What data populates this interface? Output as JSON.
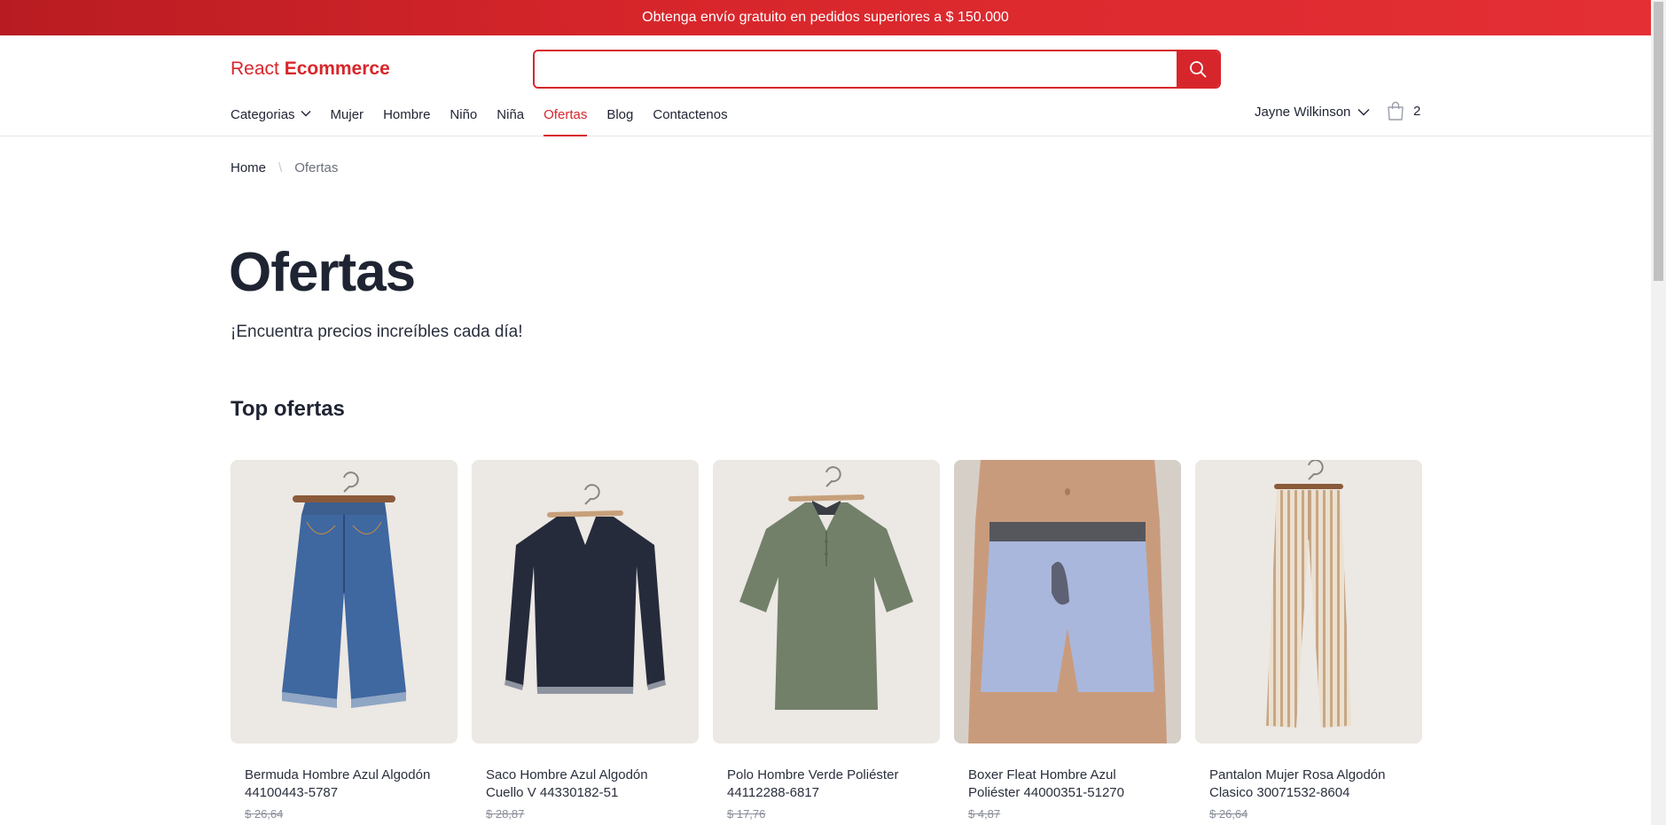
{
  "promo": {
    "text": "Obtenga envío gratuito en pedidos superiores a $ 150.000"
  },
  "logo": {
    "part1": "React ",
    "part2": "Ecommerce"
  },
  "search": {
    "placeholder": "",
    "value": ""
  },
  "nav": {
    "items": [
      {
        "label": "Categorias",
        "has_dropdown": true
      },
      {
        "label": "Mujer"
      },
      {
        "label": "Hombre"
      },
      {
        "label": "Niño"
      },
      {
        "label": "Niña"
      },
      {
        "label": "Ofertas",
        "active": true
      },
      {
        "label": "Blog"
      },
      {
        "label": "Contactenos"
      }
    ]
  },
  "user": {
    "name": "Jayne Wilkinson"
  },
  "cart": {
    "count": "2"
  },
  "breadcrumb": {
    "home": "Home",
    "current": "Ofertas"
  },
  "page": {
    "title": "Ofertas",
    "subtitle": "¡Encuentra precios increíbles cada día!",
    "section_title": "Top ofertas"
  },
  "products": [
    {
      "name": "Bermuda Hombre Azul Algodón 44100443-5787",
      "price": "$ 26,64",
      "icon": "denim-shorts-image"
    },
    {
      "name": "Saco Hombre Azul Algodón Cuello V 44330182-51",
      "price": "$ 28,87",
      "icon": "sweater-image"
    },
    {
      "name": "Polo Hombre Verde Poliéster 44112288-6817",
      "price": "$ 17,76",
      "icon": "polo-shirt-image"
    },
    {
      "name": "Boxer Fleat Hombre Azul Poliéster 44000351-51270",
      "price": "$ 4,87",
      "icon": "boxer-image"
    },
    {
      "name": "Pantalon Mujer Rosa Algodón Clasico 30071532-8604",
      "price": "$ 26,64",
      "icon": "trousers-image"
    }
  ],
  "colors": {
    "accent": "#d7262b",
    "text": "#1f2433",
    "card_bg": "#ece8e4"
  }
}
